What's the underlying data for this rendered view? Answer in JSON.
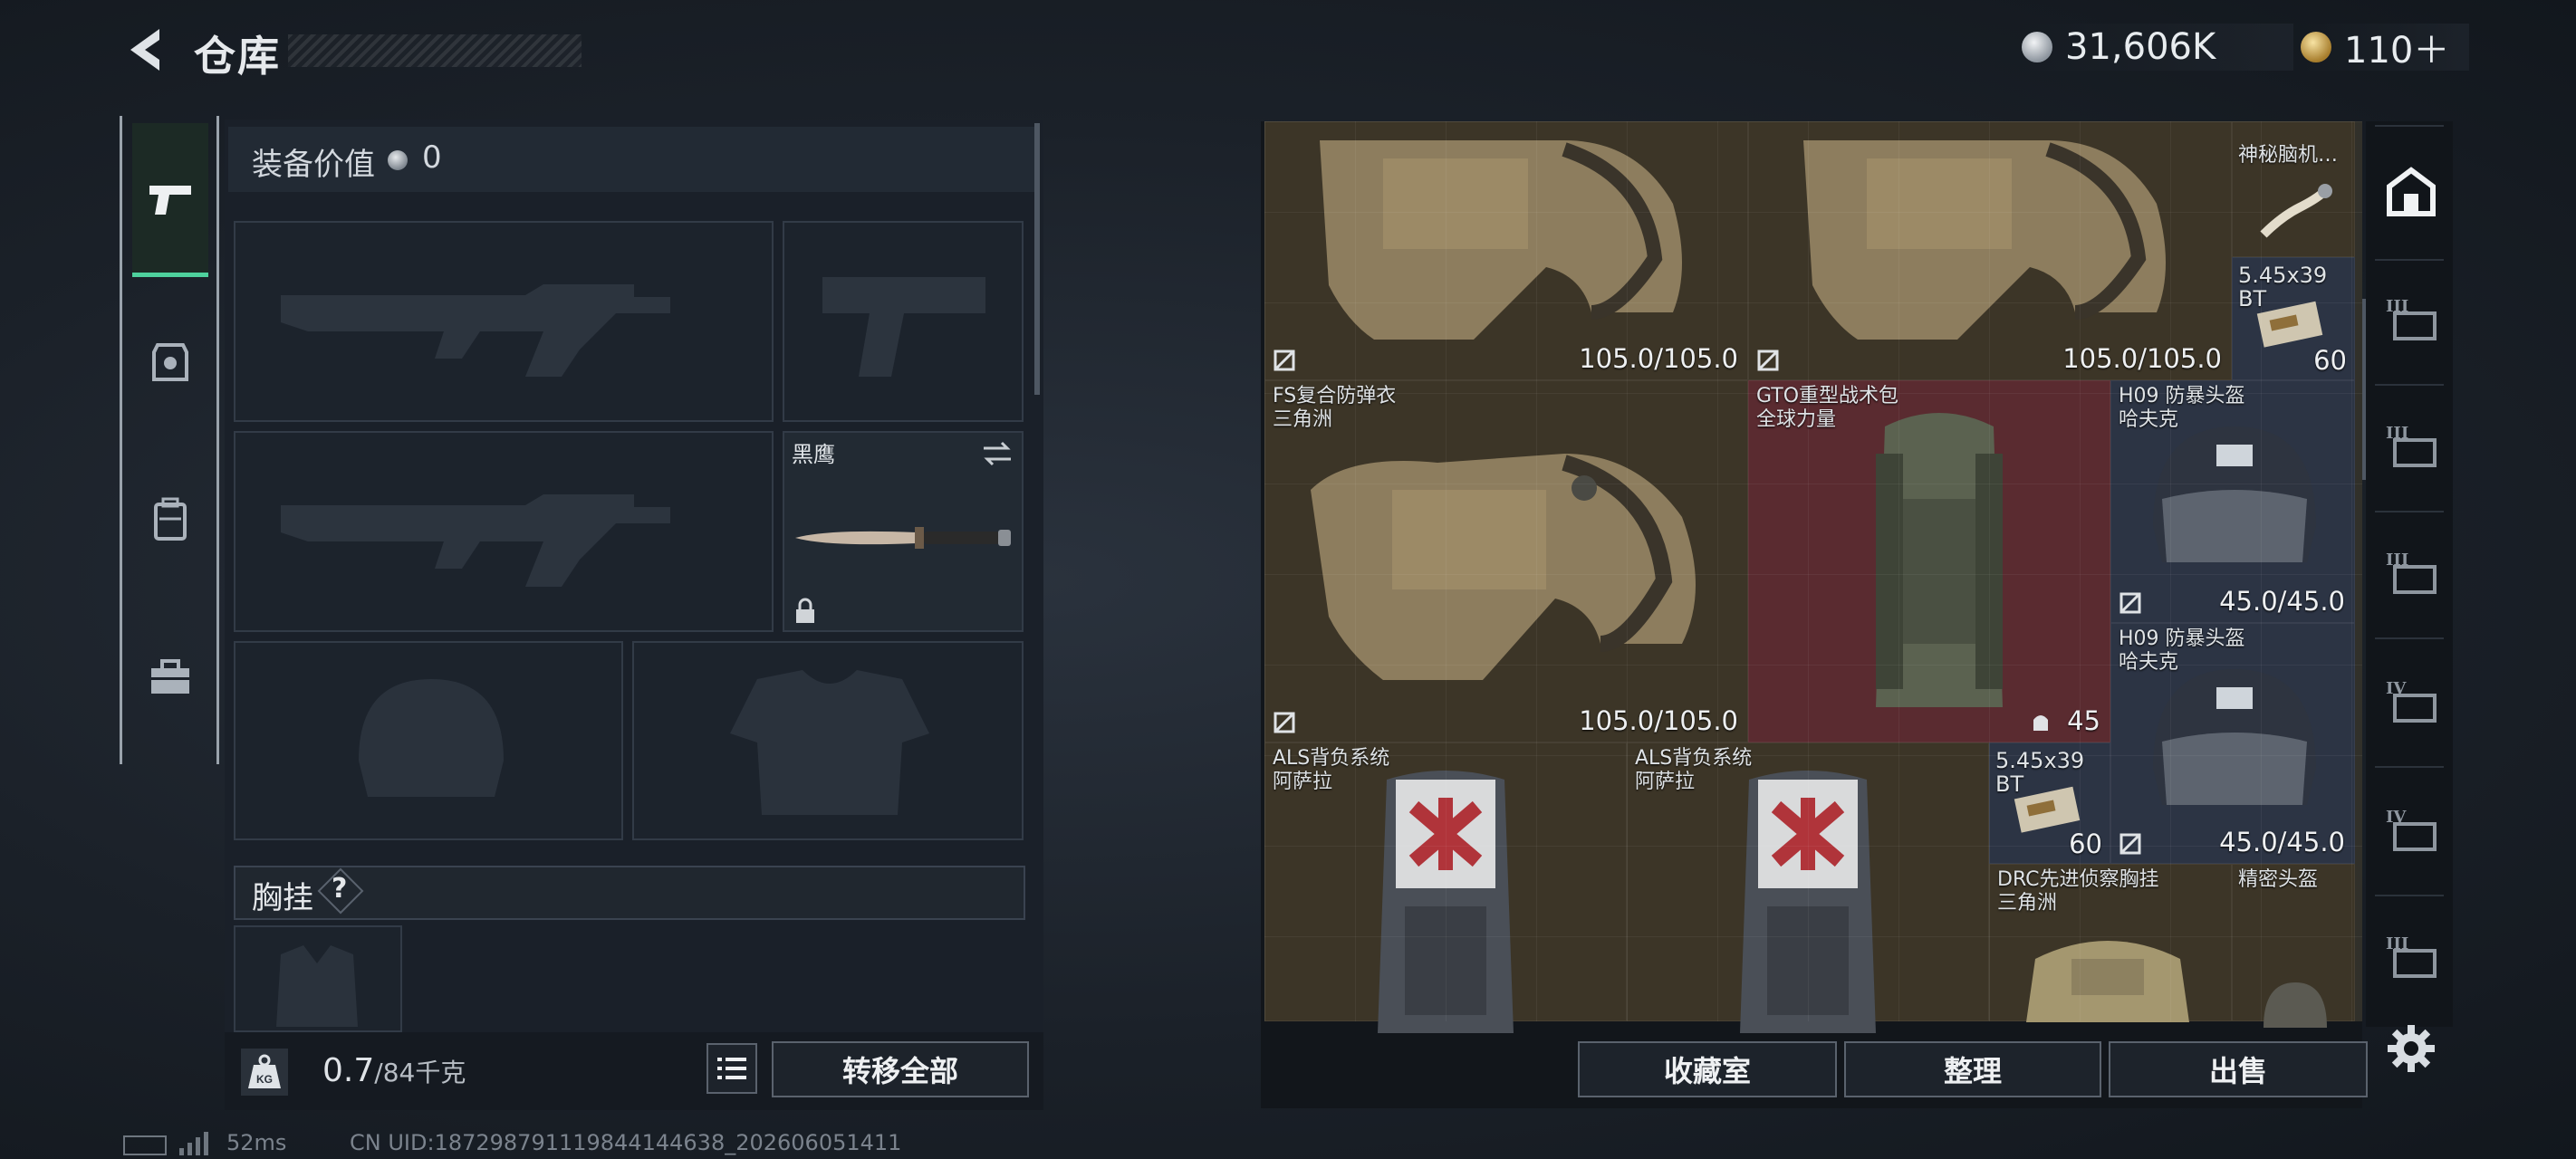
{
  "header": {
    "title": "仓库",
    "silver": "31,606K",
    "gold": "110＋"
  },
  "equip": {
    "value_label": "装备价值",
    "value": "0",
    "melee_name": "黑鹰",
    "chest_label": "胸挂",
    "help": "?"
  },
  "weight": {
    "value": "0.7",
    "unit": "/84千克"
  },
  "buttons": {
    "transfer_all": "转移全部",
    "collection": "收藏室",
    "organize": "整理",
    "sell": "出售"
  },
  "stash_items": [
    {
      "name": "",
      "sub": "",
      "durability": "105.0/105.0"
    },
    {
      "name": "",
      "sub": "",
      "durability": "105.0/105.0"
    },
    {
      "name": "神秘脑机…",
      "sub": ""
    },
    {
      "name": "5.45x39",
      "sub": "BT",
      "count": "60"
    },
    {
      "name": "FS复合防弹衣",
      "sub": "三角洲",
      "durability": "105.0/105.0"
    },
    {
      "name": "GTO重型战术包",
      "sub": "全球力量",
      "count": "45"
    },
    {
      "name": "H09 防暴头盔",
      "sub": "哈夫克",
      "durability": "45.0/45.0"
    },
    {
      "name": "H09 防暴头盔",
      "sub": "哈夫克",
      "durability": "45.0/45.0"
    },
    {
      "name": "ALS背负系统",
      "sub": "阿萨拉"
    },
    {
      "name": "ALS背负系统",
      "sub": "阿萨拉"
    },
    {
      "name": "5.45x39",
      "sub": "BT",
      "count": "60"
    },
    {
      "name": "DRC先进侦察胸挂",
      "sub": "三角洲"
    },
    {
      "name": "精密头盔",
      "sub": ""
    }
  ],
  "status": {
    "ping": "52ms",
    "uid": "CN UID:187298791119844144638_202606051411"
  },
  "icons": {
    "back": "back-arrow-icon",
    "silver": "silver-coin-icon",
    "gold": "gold-coin-icon",
    "weapon_tab": "pistol-icon",
    "helmet_tab": "armor-icon",
    "backpack_tab": "backpack-icon",
    "case_tab": "toolbox-icon",
    "weight": "kg-weight-icon",
    "list": "list-icon",
    "settings": "gear-icon"
  },
  "colors": {
    "accent_green": "#4ed19d",
    "red_cell": "#5a2b30",
    "gold_cell": "#3c3527",
    "blue_cell": "#2c3444"
  }
}
